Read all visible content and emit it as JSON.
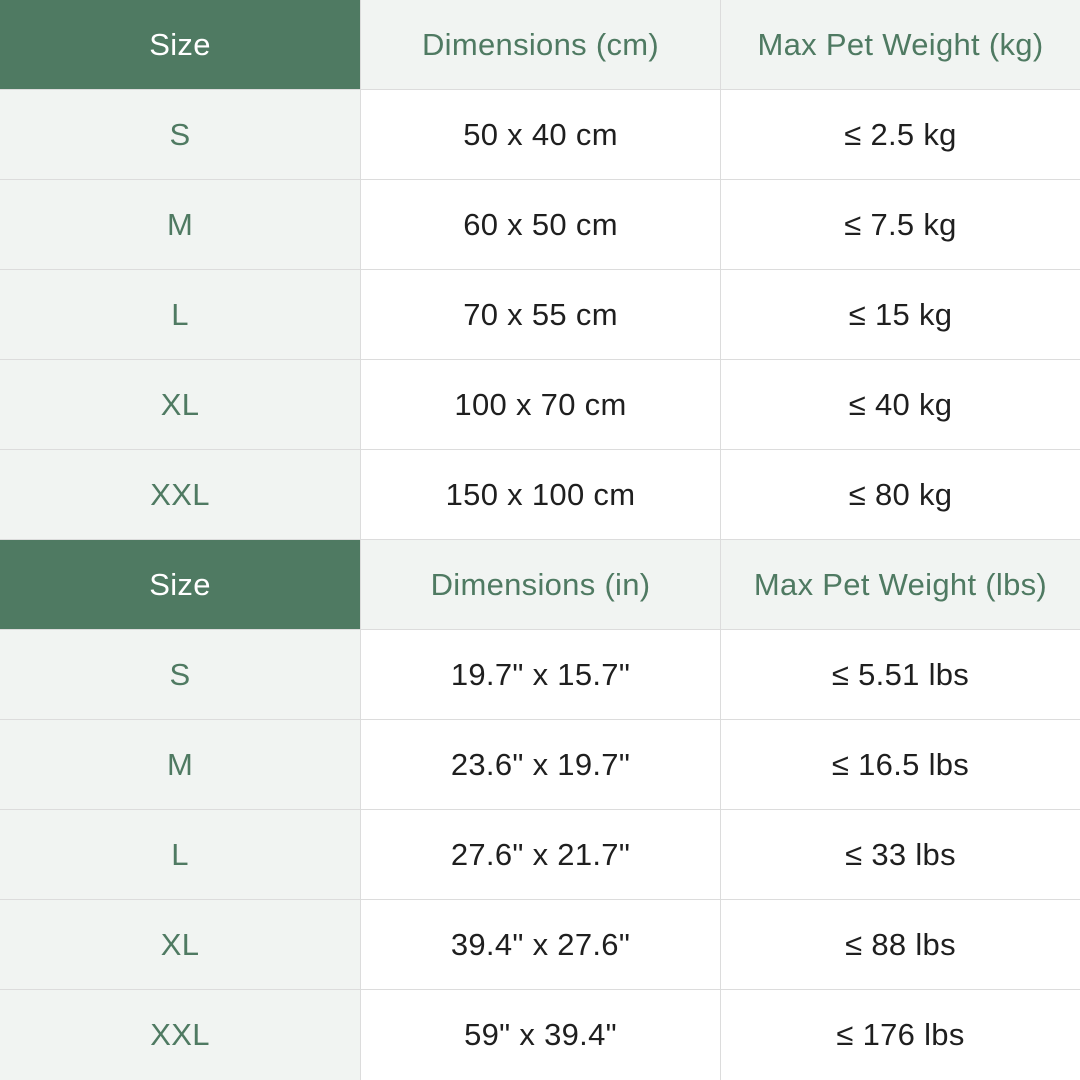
{
  "metric": {
    "headers": [
      "Size",
      "Dimensions (cm)",
      "Max Pet Weight (kg)"
    ],
    "rows": [
      [
        "S",
        "50 x 40 cm",
        "≤ 2.5 kg"
      ],
      [
        "M",
        "60 x 50 cm",
        "≤ 7.5 kg"
      ],
      [
        "L",
        "70 x 55 cm",
        "≤ 15 kg"
      ],
      [
        "XL",
        "100 x 70 cm",
        "≤ 40 kg"
      ],
      [
        "XXL",
        "150 x 100 cm",
        "≤ 80 kg"
      ]
    ]
  },
  "imperial": {
    "headers": [
      "Size",
      "Dimensions (in)",
      "Max Pet Weight (lbs)"
    ],
    "rows": [
      [
        "S",
        "19.7\" x 15.7\"",
        "≤ 5.51 lbs"
      ],
      [
        "M",
        "23.6\" x 19.7\"",
        "≤ 16.5 lbs"
      ],
      [
        "L",
        "27.6\" x 21.7\"",
        "≤ 33 lbs"
      ],
      [
        "XL",
        "39.4\" x 27.6\"",
        "≤ 88 lbs"
      ],
      [
        "XXL",
        "59\" x 39.4\"",
        "≤ 176 lbs"
      ]
    ]
  },
  "colors": {
    "header_accent": "#4f7a62",
    "size_column_bg": "#f1f4f2",
    "value_text": "#1f1f1f"
  }
}
